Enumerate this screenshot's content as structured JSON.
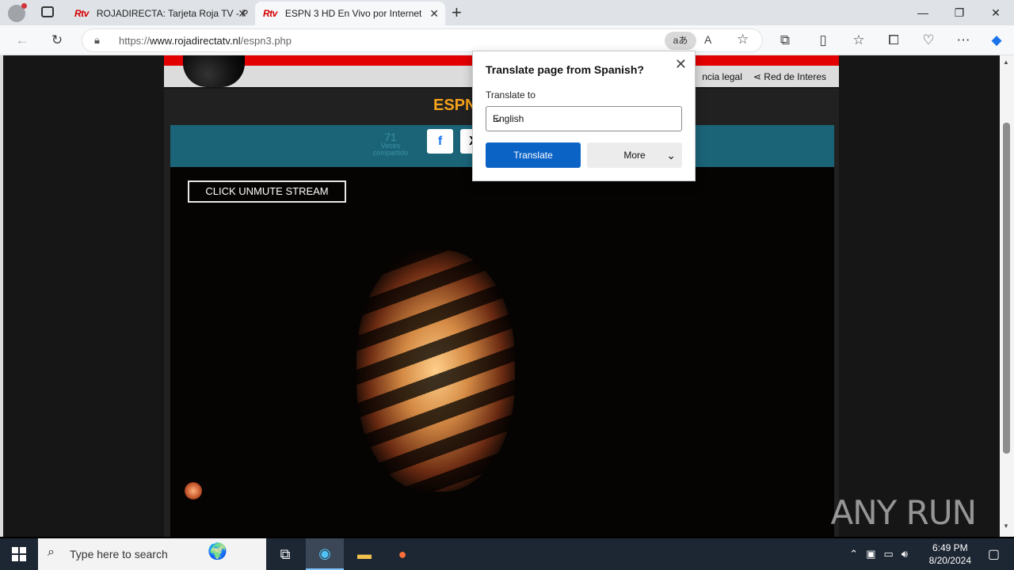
{
  "browser": {
    "tabs": [
      {
        "favicon": "Rtv",
        "title": "ROJADIRECTA: Tarjeta Roja TV - P"
      },
      {
        "favicon": "Rtv",
        "title": "ESPN 3 HD En Vivo por Internet"
      }
    ],
    "url_prefix": "https://",
    "url_host": "www.rojadirectatv.nl",
    "url_path": "/espn3.php",
    "translate_pill": "aあ"
  },
  "page": {
    "nav_links": [
      "ncia legal",
      "Red de Interes"
    ],
    "title_visible": "ESPN",
    "share_count": "71",
    "share_label_1": "Veces",
    "share_label_2": "compartido",
    "unmute_label": "CLICK UNMUTE STREAM",
    "watermark": "ANY RUN"
  },
  "translate_popup": {
    "title": "Translate page from Spanish?",
    "label": "Translate to",
    "selected_language": "English",
    "translate_button": "Translate",
    "more_button": "More"
  },
  "taskbar": {
    "search_placeholder": "Type here to search",
    "time": "6:49 PM",
    "date": "8/20/2024"
  },
  "colors": {
    "accent_orange": "#f6a21a",
    "share_bar": "#1b6478",
    "translate_blue": "#0b63c6",
    "banner_red": "#e20000"
  }
}
